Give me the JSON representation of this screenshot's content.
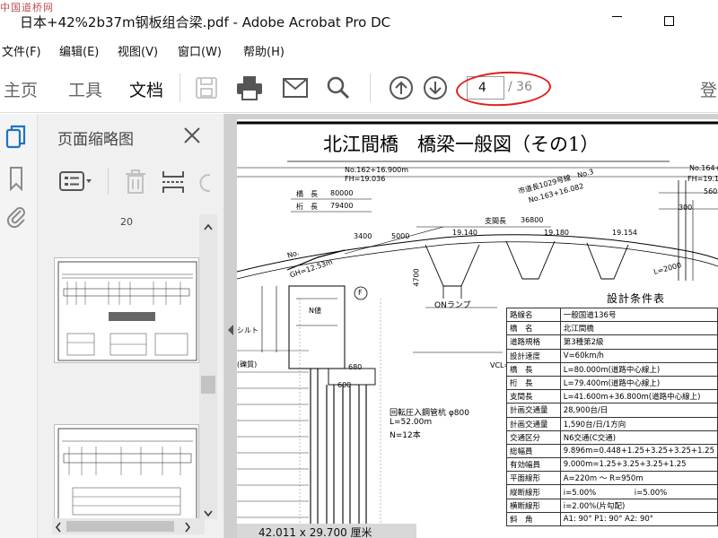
{
  "window": {
    "watermark": "中国道桥网",
    "title": "日本+42%2b37m钢板组合梁.pdf - Adobe Acrobat Pro DC"
  },
  "menu": [
    "文件(F)",
    "编辑(E)",
    "视图(V)",
    "窗口(W)",
    "帮助(H)"
  ],
  "toolbar": {
    "tabs": [
      "主页",
      "工具",
      "文档"
    ],
    "active_tab": "文档",
    "current_page": "4",
    "total_pages": "/ 36",
    "sign_in": "登"
  },
  "thumbnail_panel": {
    "title": "页面缩略图",
    "partial_label": "20",
    "labels": [
      "21"
    ]
  },
  "document": {
    "title": "北江間橋　橋梁一般図（その1）",
    "page_size": "42.011 x 29.700 厘米",
    "drawing_labels": {
      "no162": "No.162+16.900m",
      "fh1": "FH=19.036",
      "bridge_len_k": "橋　長",
      "bridge_len_v": "80000",
      "girder_len_k": "桁　長",
      "girder_len_v": "79400",
      "span_k": "支間長",
      "span_v": "36800",
      "road1029": "市道長1029号線　No.3",
      "no163": "No.163+16.082",
      "no164": "No.164+",
      "fh2": "FH=19.1",
      "d560": "560",
      "d300": "300",
      "d3400": "3400",
      "d5000": "5000",
      "e1": "19.140",
      "e2": "19.180",
      "e3": "19.154",
      "l2000": "L=2000",
      "ramp": "ONランプ",
      "d4700": "4700",
      "d680": "680",
      "d600": "600",
      "gh": "GH=12.53m",
      "no1": "No.",
      "circle_f": "F",
      "n_mark": "N値",
      "pile": "回転圧入鋼管杭 φ800",
      "pile_l": "L=52.00m",
      "pile_n": "N=12本",
      "silt": "シルト",
      "vcl": "VCL=",
      "gravel": "(礫質)"
    },
    "design_conditions_title": "設計条件表",
    "design_conditions": [
      [
        "路線名",
        "一般国道136号"
      ],
      [
        "橋　名",
        "北江間橋"
      ],
      [
        "道路規格",
        "第3種第2級"
      ],
      [
        "設計速度",
        "V=60km/h"
      ],
      [
        "橋　長",
        "L=80.000m(道路中心線上)"
      ],
      [
        "桁　長",
        "L=79.400m(道路中心線上)"
      ],
      [
        "支間長",
        "L=41.600m+36.800m(道路中心線上)"
      ],
      [
        "計画交通量",
        "28,900台/日"
      ],
      [
        "計画交通量",
        "1,590台/日/1方向"
      ],
      [
        "交通区分",
        "N6交通(C交通)"
      ],
      [
        "総幅員",
        "9.896m=0.448+1.25+3.25+3.25+1.25"
      ],
      [
        "有効幅員",
        "9.000m=1.25+3.25+3.25+1.25"
      ],
      [
        "平面線形",
        "A=220m ～ R=950m"
      ],
      [
        "縦断線形",
        "i=5.00%　　　　　i=5.00%"
      ],
      [
        "横断線形",
        "i=2.00%(片勾配)"
      ],
      [
        "斜　角",
        "A1: 90°  P1: 90°  A2: 90°"
      ]
    ]
  },
  "colors": {
    "highlight_ellipse": "#e02020",
    "active_tab": "#111111",
    "inactive": "#666666",
    "accent_icon": "#1e73be"
  },
  "icons": {
    "save": "save-icon",
    "print": "print-icon",
    "mail": "mail-icon",
    "search": "search-icon",
    "prev": "prev-page-icon",
    "next": "next-page-icon"
  }
}
